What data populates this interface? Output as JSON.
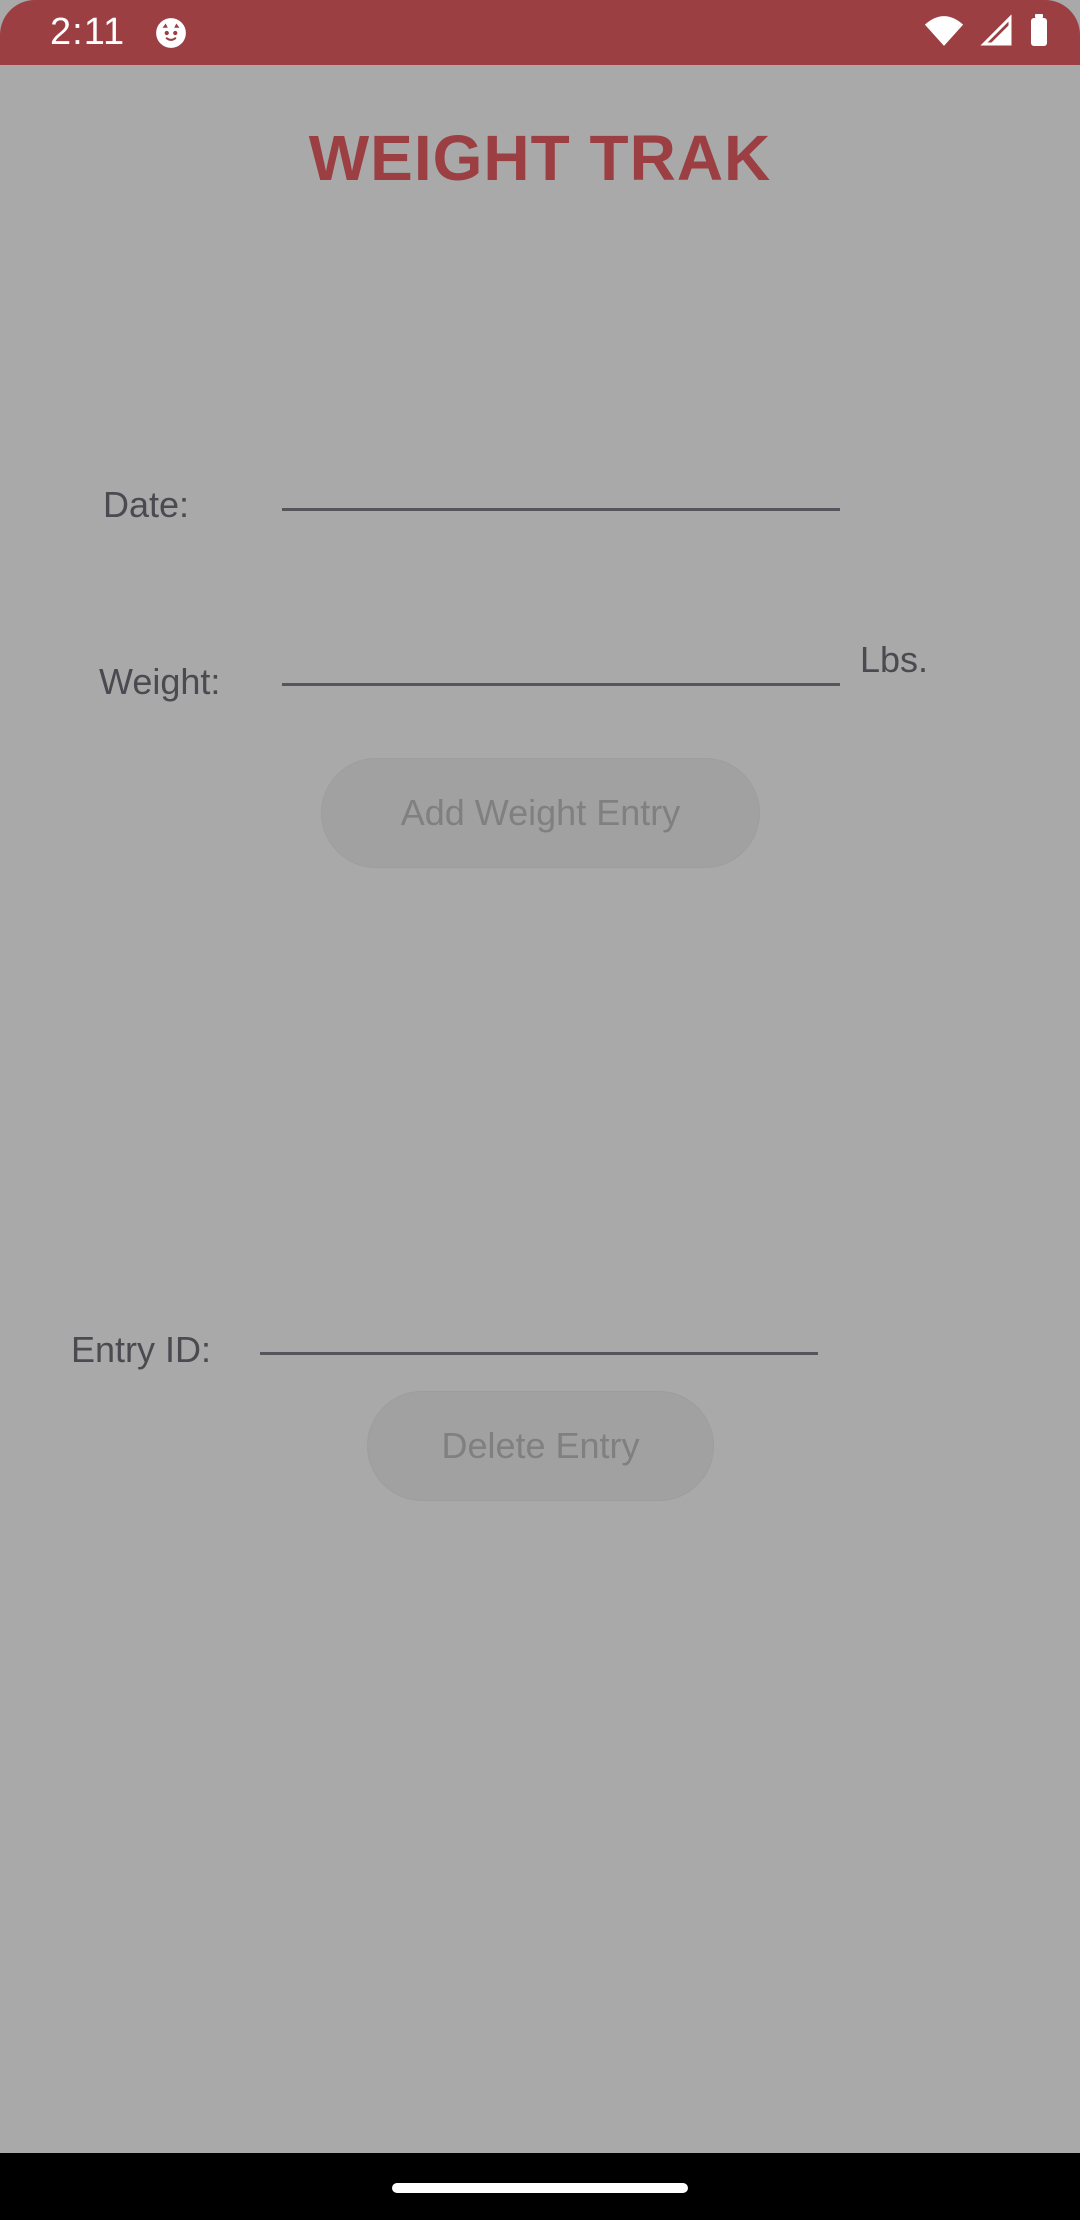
{
  "status_bar": {
    "time": "2:11",
    "icons": [
      "cat-icon",
      "wifi-icon",
      "cell-signal-icon",
      "battery-icon"
    ]
  },
  "app": {
    "title": "WEIGHT TRAK",
    "fields": {
      "date_label": "Date:",
      "weight_label": "Weight:",
      "units_label": "Lbs.",
      "entry_id_label": "Entry ID:"
    },
    "buttons": {
      "add_weight": "Add Weight Entry",
      "delete_entry": "Delete Entry"
    }
  },
  "colors": {
    "brand": "#9B3F43",
    "background": "#A9A9A9",
    "text": "#4A4A50",
    "button_bg": "#A1A1A1",
    "button_text": "#808080"
  }
}
